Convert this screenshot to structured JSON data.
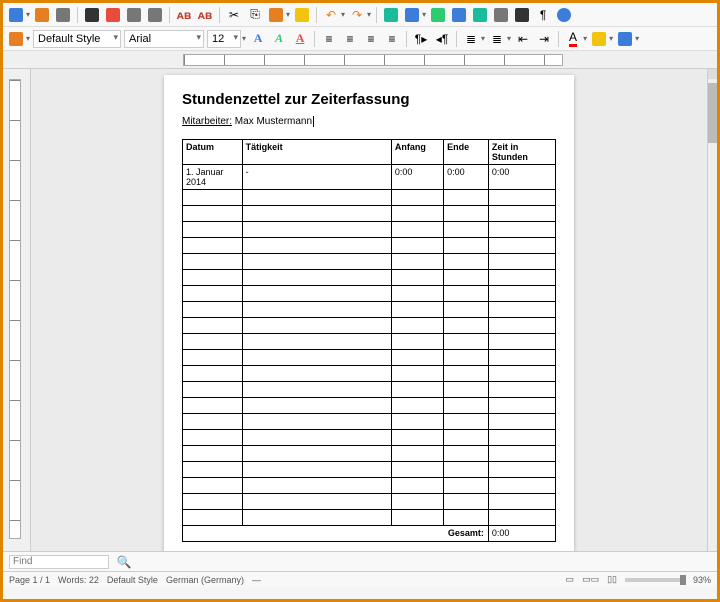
{
  "toolbar": {
    "style_label": "Default Style",
    "font_name": "Arial",
    "font_size": "12"
  },
  "document": {
    "title": "Stundenzettel zur Zeiterfassung",
    "employee_label": "Mitarbeiter:",
    "employee_name": "Max Mustermann",
    "table": {
      "headers": {
        "datum": "Datum",
        "taetigkeit": "Tätigkeit",
        "anfang": "Anfang",
        "ende": "Ende",
        "zeit": "Zeit in Stunden"
      },
      "rows": [
        {
          "datum": "1. Januar 2014",
          "taetigkeit": "-",
          "anfang": "0:00",
          "ende": "0:00",
          "zeit": "0:00"
        },
        {
          "datum": "",
          "taetigkeit": "",
          "anfang": "",
          "ende": "",
          "zeit": ""
        },
        {
          "datum": "",
          "taetigkeit": "",
          "anfang": "",
          "ende": "",
          "zeit": ""
        },
        {
          "datum": "",
          "taetigkeit": "",
          "anfang": "",
          "ende": "",
          "zeit": ""
        },
        {
          "datum": "",
          "taetigkeit": "",
          "anfang": "",
          "ende": "",
          "zeit": ""
        },
        {
          "datum": "",
          "taetigkeit": "",
          "anfang": "",
          "ende": "",
          "zeit": ""
        },
        {
          "datum": "",
          "taetigkeit": "",
          "anfang": "",
          "ende": "",
          "zeit": ""
        },
        {
          "datum": "",
          "taetigkeit": "",
          "anfang": "",
          "ende": "",
          "zeit": ""
        },
        {
          "datum": "",
          "taetigkeit": "",
          "anfang": "",
          "ende": "",
          "zeit": ""
        },
        {
          "datum": "",
          "taetigkeit": "",
          "anfang": "",
          "ende": "",
          "zeit": ""
        },
        {
          "datum": "",
          "taetigkeit": "",
          "anfang": "",
          "ende": "",
          "zeit": ""
        },
        {
          "datum": "",
          "taetigkeit": "",
          "anfang": "",
          "ende": "",
          "zeit": ""
        },
        {
          "datum": "",
          "taetigkeit": "",
          "anfang": "",
          "ende": "",
          "zeit": ""
        },
        {
          "datum": "",
          "taetigkeit": "",
          "anfang": "",
          "ende": "",
          "zeit": ""
        },
        {
          "datum": "",
          "taetigkeit": "",
          "anfang": "",
          "ende": "",
          "zeit": ""
        },
        {
          "datum": "",
          "taetigkeit": "",
          "anfang": "",
          "ende": "",
          "zeit": ""
        },
        {
          "datum": "",
          "taetigkeit": "",
          "anfang": "",
          "ende": "",
          "zeit": ""
        },
        {
          "datum": "",
          "taetigkeit": "",
          "anfang": "",
          "ende": "",
          "zeit": ""
        },
        {
          "datum": "",
          "taetigkeit": "",
          "anfang": "",
          "ende": "",
          "zeit": ""
        },
        {
          "datum": "",
          "taetigkeit": "",
          "anfang": "",
          "ende": "",
          "zeit": ""
        },
        {
          "datum": "",
          "taetigkeit": "",
          "anfang": "",
          "ende": "",
          "zeit": ""
        },
        {
          "datum": "",
          "taetigkeit": "",
          "anfang": "",
          "ende": "",
          "zeit": ""
        }
      ],
      "total_label": "Gesamt:",
      "total_value": "0:00"
    }
  },
  "findbar": {
    "placeholder": "Find"
  },
  "statusbar": {
    "page": "Page 1 / 1",
    "words": "Words: 22",
    "style": "Default Style",
    "language": "German (Germany)",
    "insert_mode": "—",
    "zoom": "93%"
  }
}
